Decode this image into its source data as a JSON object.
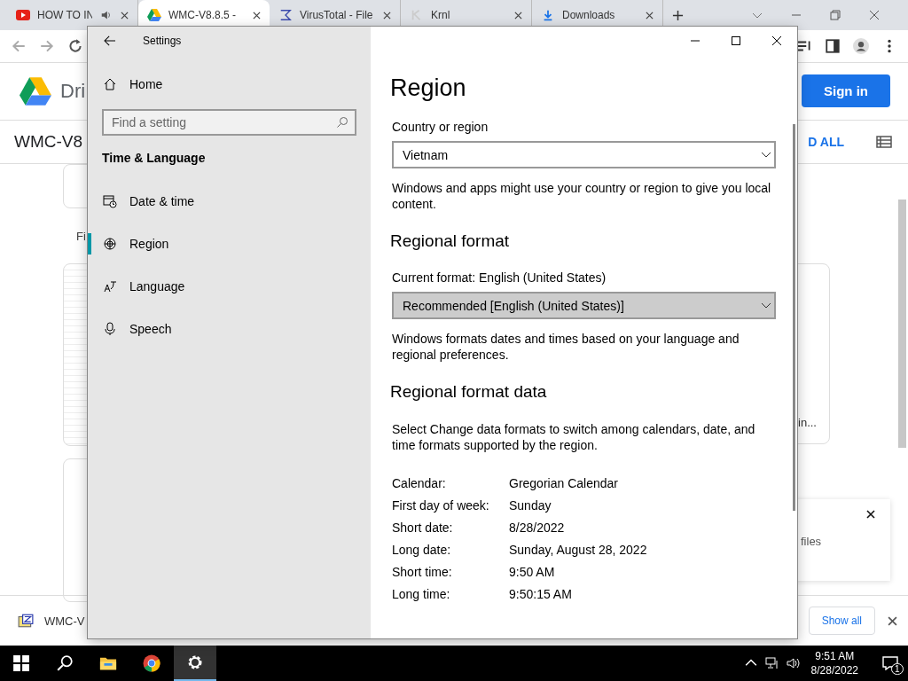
{
  "browser": {
    "tabs": [
      {
        "title": "HOW TO IN",
        "selected": false,
        "kind": "youtube"
      },
      {
        "title": "WMC-V8.8.5 - ",
        "selected": true,
        "kind": "drive"
      },
      {
        "title": "VirusTotal - File",
        "selected": false,
        "kind": "virustotal"
      },
      {
        "title": "Krnl",
        "selected": false,
        "kind": "krnl"
      },
      {
        "title": "Downloads",
        "selected": false,
        "kind": "download"
      }
    ],
    "header": {
      "logo_text": "Dri",
      "sign_in": "Sign in"
    },
    "subheader": {
      "title": "WMC-V8",
      "action": "D ALL"
    },
    "content": {
      "label": "Fi",
      "card_caption": "in...",
      "popup_text": "files"
    },
    "download_bar": {
      "file": "WMC-V",
      "show_all": "Show all"
    }
  },
  "settings": {
    "title": "Settings",
    "home": "Home",
    "search": {
      "placeholder": "Find a setting"
    },
    "section": "Time & Language",
    "nav": [
      {
        "label": "Date & time",
        "kind": "clock",
        "selected": false
      },
      {
        "label": "Region",
        "kind": "globe",
        "selected": true
      },
      {
        "label": "Language",
        "kind": "language",
        "selected": false
      },
      {
        "label": "Speech",
        "kind": "mic",
        "selected": false
      }
    ],
    "page_title": "Region",
    "country_label": "Country or region",
    "country_value": "Vietnam",
    "country_desc": "Windows and apps might use your country or region to give you local content.",
    "format_heading": "Regional format",
    "current_format": "Current format: English (United States)",
    "format_value": "Recommended [English (United States)]",
    "format_desc": "Windows formats dates and times based on your language and regional preferences.",
    "data_heading": "Regional format data",
    "data_desc": "Select Change data formats to switch among calendars, date, and time formats supported by the region.",
    "data_rows": [
      {
        "label": "Calendar:",
        "value": "Gregorian Calendar"
      },
      {
        "label": "First day of week:",
        "value": "Sunday"
      },
      {
        "label": "Short date:",
        "value": "8/28/2022"
      },
      {
        "label": "Long date:",
        "value": "Sunday, August 28, 2022"
      },
      {
        "label": "Short time:",
        "value": "9:50 AM"
      },
      {
        "label": "Long time:",
        "value": "9:50:15 AM"
      }
    ]
  },
  "taskbar": {
    "time": "9:51 AM",
    "date": "8/28/2022",
    "notifications": "1"
  }
}
